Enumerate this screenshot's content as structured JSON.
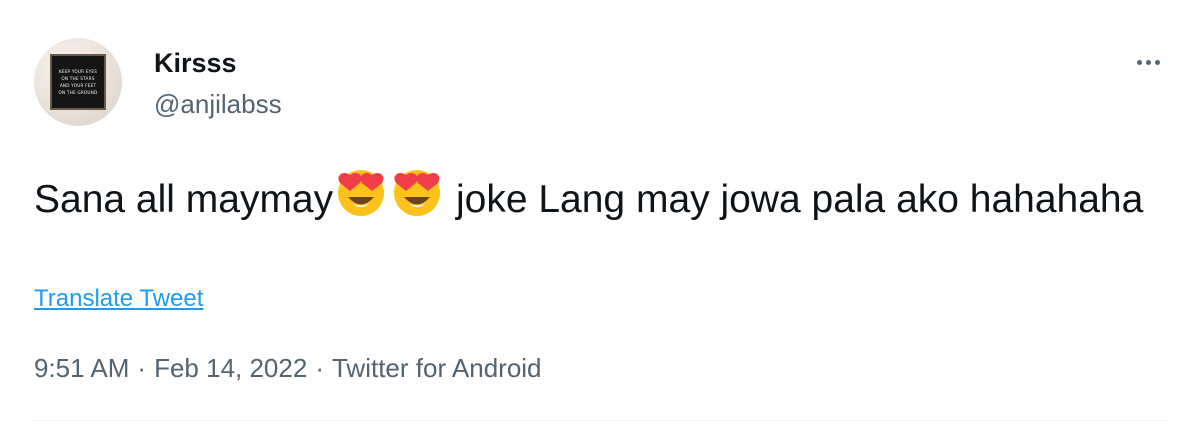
{
  "author": {
    "display_name": "Kirsss",
    "handle": "@anjilabss",
    "avatar_board_lines": [
      "KEEP YOUR EYES",
      "ON THE STARS",
      "AND YOUR FEET",
      "ON THE GROUND"
    ]
  },
  "tweet": {
    "text_before_emoji": "Sana all maymay",
    "emoji_name": "smiling-face-with-heart-eyes-icon",
    "text_after_emoji": " joke Lang may jowa pala ako hahahaha",
    "translate_label": "Translate Tweet"
  },
  "meta": {
    "time": "9:51 AM",
    "separator": "·",
    "date": "Feb 14, 2022",
    "source": "Twitter for Android"
  },
  "colors": {
    "primary_text": "#0f1419",
    "secondary_text": "#536471",
    "link": "#1d9bf0"
  },
  "icons": {
    "more": "more-dots-icon",
    "emoji": "smiling-face-with-heart-eyes-icon"
  }
}
